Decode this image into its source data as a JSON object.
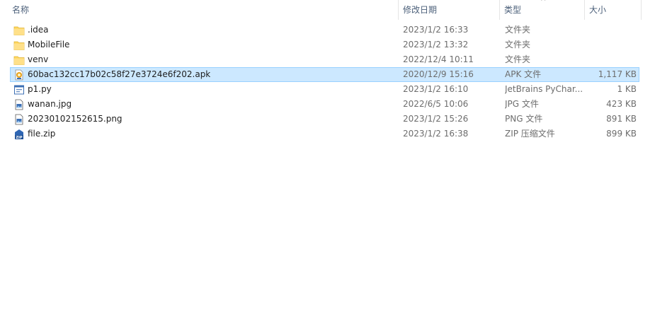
{
  "columns": {
    "name": "名称",
    "date": "修改日期",
    "type": "类型",
    "size": "大小",
    "sort_indicator": "^"
  },
  "files": [
    {
      "name": ".idea",
      "date": "2023/1/2 16:33",
      "type": "文件夹",
      "size": "",
      "icon": "folder-icon",
      "selected": false
    },
    {
      "name": "MobileFile",
      "date": "2023/1/2 13:32",
      "type": "文件夹",
      "size": "",
      "icon": "folder-icon",
      "selected": false
    },
    {
      "name": "venv",
      "date": "2022/12/4 10:11",
      "type": "文件夹",
      "size": "",
      "icon": "folder-icon",
      "selected": false
    },
    {
      "name": "60bac132cc17b02c58f27e3724e6f202.apk",
      "date": "2020/12/9 15:16",
      "type": "APK 文件",
      "size": "1,117 KB",
      "icon": "apk-file-icon",
      "selected": true
    },
    {
      "name": "p1.py",
      "date": "2023/1/2 16:10",
      "type": "JetBrains PyChar...",
      "size": "1 KB",
      "icon": "python-file-icon",
      "selected": false
    },
    {
      "name": "wanan.jpg",
      "date": "2022/6/5 10:06",
      "type": "JPG 文件",
      "size": "423 KB",
      "icon": "image-file-icon",
      "selected": false
    },
    {
      "name": "20230102152615.png",
      "date": "2023/1/2 15:26",
      "type": "PNG 文件",
      "size": "891 KB",
      "icon": "image-file-icon",
      "selected": false
    },
    {
      "name": "file.zip",
      "date": "2023/1/2 16:38",
      "type": "ZIP 压缩文件",
      "size": "899 KB",
      "icon": "zip-file-icon",
      "selected": false
    }
  ],
  "colors": {
    "selection_bg": "#cce8ff",
    "selection_border": "#99d1ff",
    "header_text": "#4c607a",
    "folder": "#ffd65c"
  }
}
